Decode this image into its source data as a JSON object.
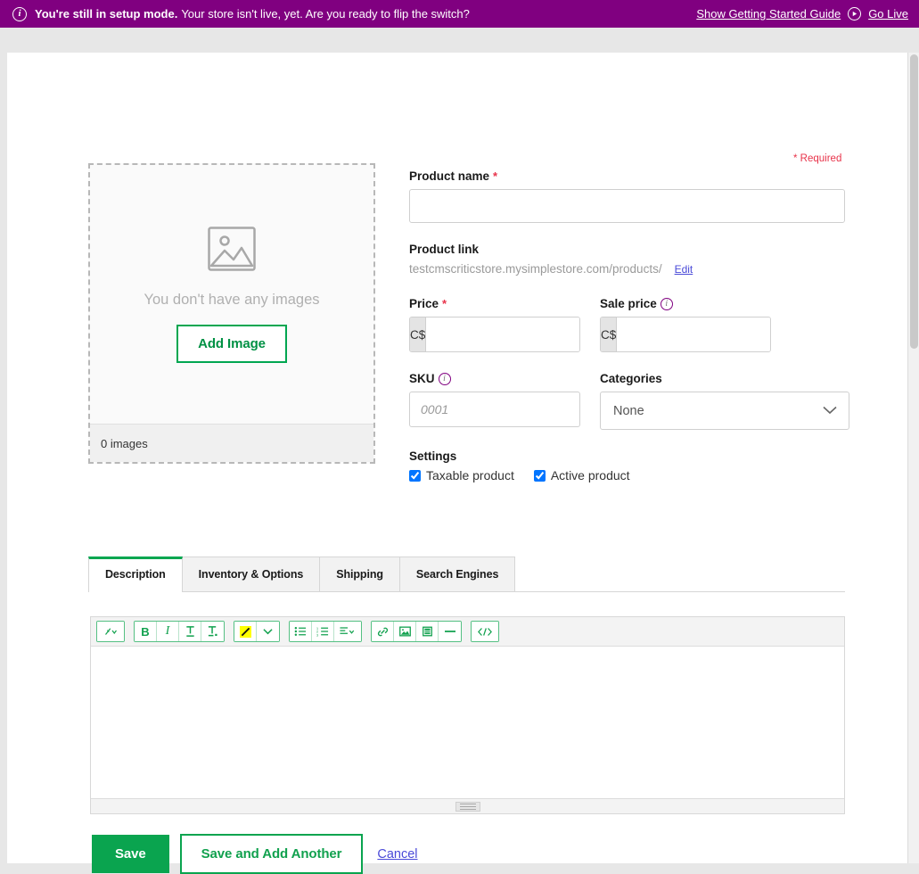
{
  "banner": {
    "info_icon": "info-circle-icon",
    "strong_text": "You're still in setup mode.",
    "rest_text": "Your store isn't live, yet. Are you ready to flip the switch?",
    "guide_link": "Show Getting Started Guide",
    "golive_icon": "play-circle-icon",
    "golive_link": "Go Live",
    "background_color": "#800080"
  },
  "form": {
    "required_note": "* Required",
    "product_name": {
      "label": "Product name",
      "required_marker": "*",
      "value": "",
      "placeholder": ""
    },
    "product_link": {
      "label": "Product link",
      "url": "testcmscriticstore.mysimplestore.com/products/",
      "edit_label": "Edit"
    },
    "price": {
      "label": "Price",
      "required_marker": "*",
      "currency": "C$",
      "value": "",
      "placeholder": ""
    },
    "sale_price": {
      "label": "Sale price",
      "info_icon": "info-circle-icon",
      "currency": "C$",
      "value": "",
      "placeholder": ""
    },
    "sku": {
      "label": "SKU",
      "info_icon": "info-circle-icon",
      "value": "",
      "placeholder": "0001"
    },
    "categories": {
      "label": "Categories",
      "selected": "None",
      "chevron_icon": "chevron-down-icon"
    },
    "settings": {
      "label": "Settings",
      "checkboxes": [
        {
          "label": "Taxable product",
          "checked": true
        },
        {
          "label": "Active product",
          "checked": true
        }
      ]
    }
  },
  "image_uploader": {
    "placeholder_icon": "image-placeholder-icon",
    "empty_text": "You don't have any images",
    "add_button": "Add Image",
    "count_text": "0 images"
  },
  "tabs": [
    {
      "label": "Description",
      "active": true
    },
    {
      "label": "Inventory & Options",
      "active": false
    },
    {
      "label": "Shipping",
      "active": false
    },
    {
      "label": "Search Engines",
      "active": false
    }
  ],
  "editor": {
    "content": "",
    "toolbar_groups": [
      {
        "buttons": [
          {
            "icon": "format-styles-icon",
            "glyph": "⤴"
          },
          {
            "icon": "chevron-down-icon",
            "glyph": "⌄"
          }
        ]
      },
      {
        "buttons": [
          {
            "icon": "bold-icon",
            "glyph": "B"
          },
          {
            "icon": "italic-icon",
            "glyph": "I"
          },
          {
            "icon": "underline-icon",
            "glyph": "I"
          },
          {
            "icon": "clear-formatting-icon",
            "glyph": "I"
          }
        ]
      },
      {
        "buttons": [
          {
            "icon": "highlight-color-icon",
            "glyph": ""
          },
          {
            "icon": "chevron-down-icon",
            "glyph": "⌄"
          }
        ]
      },
      {
        "buttons": [
          {
            "icon": "bullet-list-icon",
            "glyph": ""
          },
          {
            "icon": "numbered-list-icon",
            "glyph": ""
          },
          {
            "icon": "align-icon",
            "glyph": ""
          },
          {
            "icon": "chevron-down-icon",
            "glyph": "⌄"
          }
        ]
      },
      {
        "buttons": [
          {
            "icon": "link-icon",
            "glyph": "🔗"
          },
          {
            "icon": "insert-image-icon",
            "glyph": ""
          },
          {
            "icon": "insert-video-icon",
            "glyph": ""
          },
          {
            "icon": "horizontal-rule-icon",
            "glyph": "—"
          }
        ]
      },
      {
        "buttons": [
          {
            "icon": "source-code-icon",
            "glyph": "</>"
          }
        ]
      }
    ],
    "resize_handle": "resize-grip-handle"
  },
  "actions": {
    "save_label": "Save",
    "save_add_another_label": "Save and Add Another",
    "cancel_label": "Cancel"
  },
  "colors": {
    "brand_purple": "#800080",
    "accent_green": "#0aa44f",
    "required_red": "#e8334a",
    "link_blue": "#4a4ad8"
  }
}
